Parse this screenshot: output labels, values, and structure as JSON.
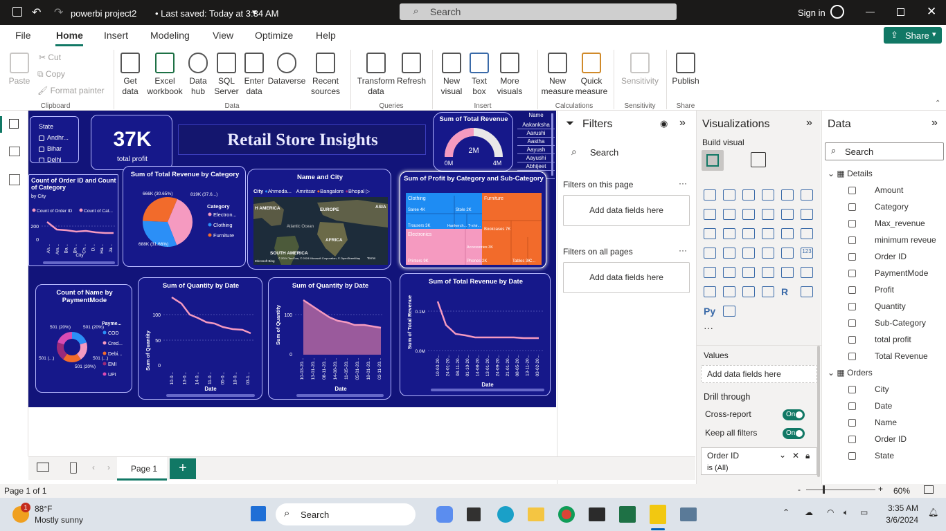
{
  "titlebar": {
    "file_name": "powerbi project2",
    "saved": "• Last saved: Today at 3:34 AM",
    "search": "Search",
    "signin": "Sign in"
  },
  "tabs": [
    "File",
    "Home",
    "Insert",
    "Modeling",
    "View",
    "Optimize",
    "Help"
  ],
  "share": "Share",
  "ribbon": {
    "clipboard": {
      "paste": "Paste",
      "cut": "Cut",
      "copy": "Copy",
      "format_painter": "Format painter",
      "group": "Clipboard"
    },
    "data": {
      "items": [
        "Get data",
        "Excel workbook",
        "Data hub",
        "SQL Server",
        "Enter data",
        "Dataverse",
        "Recent sources"
      ],
      "group": "Data"
    },
    "queries": {
      "items": [
        "Transform data",
        "Refresh"
      ],
      "group": "Queries"
    },
    "insert": {
      "items": [
        "New visual",
        "Text box",
        "More visuals"
      ],
      "group": "Insert"
    },
    "calculations": {
      "items": [
        "New measure",
        "Quick measure"
      ],
      "group": "Calculations"
    },
    "sensitivity": {
      "items": [
        "Sensitivity"
      ],
      "group": "Sensitivity"
    },
    "share": {
      "items": [
        "Publish"
      ],
      "group": "Share"
    }
  },
  "report": {
    "title": "Retail Store Insights",
    "kpi": {
      "value": "37K",
      "label": "total profit"
    },
    "state_slicer": {
      "title": "State",
      "items": [
        "Andhr...",
        "Bihar",
        "Delhi"
      ]
    },
    "name_slicer": {
      "title": "Name",
      "items": [
        "Aakanksha",
        "Aarushi",
        "Aastha",
        "Aayush",
        "Aayushi",
        "Abhijeet",
        "Abhiji..."
      ]
    },
    "gauge": {
      "title": "Sum of Total Revenue",
      "value": "2M",
      "min": "0M",
      "max": "4M",
      "fraction": 0.5
    },
    "combo": {
      "title": "Count of Order ID and Count of Category",
      "subtitle": "by City",
      "legend": [
        "Count of Order ID",
        "Count of Cat..."
      ],
      "y_ticks": [
        "200",
        "0"
      ],
      "x_label": "City",
      "x_ticks": [
        "Ah...",
        "Am...",
        "Ba...",
        "Bh...",
        "Ch...",
        "D...",
        "Ha...",
        "Ja..."
      ]
    },
    "pie": {
      "title": "Sum of Total Revenue by Category",
      "legend_title": "Category",
      "legend": [
        "Electron...",
        "Clothing",
        "Furniture"
      ],
      "labels": [
        "819K (37.6...)",
        "688K (31.66%)",
        "666K (30.65%)"
      ]
    },
    "map": {
      "title": "Name and City",
      "legend_title": "City",
      "legend": [
        "Ahmeda...",
        "Amritsar",
        "Bangalore",
        "Bhopal"
      ],
      "regions": [
        "H AMERICA",
        "EUROPE",
        "ASIA",
        "Atlantic Ocean",
        "AFRICA",
        "SOUTH AMERICA"
      ],
      "credit": "© 2024 TomTom, © 2024 Microsoft Corporation, © OpenStreetMap",
      "terms": "Terms",
      "brand": "Microsoft Bing"
    },
    "treemap": {
      "title": "Sum of Profit by Category and Sub-Category",
      "tiles": [
        "Clothing",
        "Furniture",
        "Saree 4K",
        "Stole 2K",
        "Trousers 3K",
        "Hankerch...",
        "T-shir...",
        "Bookcases 7K",
        "Electronics",
        "Accessories 3K",
        "Printers 9K",
        "Phones 2K",
        "Tables 3K",
        "C..."
      ]
    },
    "donut": {
      "title": "Count of Name by PaymentMode",
      "legend_title": "Payme...",
      "legend": [
        "COD",
        "Cred...",
        "Debi...",
        "EMI",
        "UPI"
      ],
      "labels": [
        "501 (20%)",
        "501 (20%)",
        "501 (...)",
        "501 (20%)",
        "501 (...)"
      ]
    },
    "qty1": {
      "title": "Sum of Quantity by Date",
      "y_label": "Sum of Quantity",
      "x_label": "Date",
      "y_ticks": [
        "100",
        "50",
        "0"
      ],
      "x_ticks": [
        "10-0...",
        "13-0...",
        "14-0...",
        "11-0...",
        "05-0...",
        "18-0...",
        "03-1..."
      ]
    },
    "qty2": {
      "title": "Sum of Quantity by Date",
      "y_label": "Sum of Quantity",
      "x_label": "Date",
      "y_ticks": [
        "100",
        "0"
      ],
      "x_ticks": [
        "10-03-20...",
        "13-01-20...",
        "08-11-20...",
        "14-08-20...",
        "11-05-20...",
        "05-01-20...",
        "18-01-20...",
        "03-11-20..."
      ]
    },
    "rev": {
      "title": "Sum of Total Revenue by Date",
      "y_label": "Sum of Total Revenue",
      "x_label": "Date",
      "y_ticks": [
        "0.1M",
        "0.0M"
      ],
      "x_ticks": [
        "10-03-20...",
        "24-01-20...",
        "08-11-20...",
        "01-10-20...",
        "14-08-20...",
        "13-01-20...",
        "24-09-20...",
        "21-01-20...",
        "08-05-20...",
        "13-11-20...",
        "03-02-20..."
      ]
    }
  },
  "filters": {
    "title": "Filters",
    "search": "Search",
    "on_page": "Filters on this page",
    "on_all": "Filters on all pages",
    "add": "Add data fields here"
  },
  "viz": {
    "title": "Visualizations",
    "build": "Build visual",
    "values": "Values",
    "add": "Add data fields here",
    "drill": "Drill through",
    "cross": "Cross-report",
    "keep": "Keep all filters",
    "on": "On",
    "order_filter": "Order ID",
    "order_filter_val": "is (All)",
    "icon_labels": [
      "Py",
      "R",
      "123"
    ]
  },
  "data_pane": {
    "title": "Data",
    "search": "Search",
    "tables": [
      {
        "name": "Details",
        "fields": [
          "Amount",
          "Category",
          "Max_revenue",
          "minimum reveue",
          "Order ID",
          "PaymentMode",
          "Profit",
          "Quantity",
          "Sub-Category",
          "total profit",
          "Total Revenue"
        ]
      },
      {
        "name": "Orders",
        "fields": [
          "City",
          "Date",
          "Name",
          "Order ID",
          "State"
        ]
      }
    ]
  },
  "pages": {
    "current": "Page 1",
    "add": "+"
  },
  "status": {
    "page": "Page 1 of 1",
    "zoom": "60%"
  },
  "taskbar": {
    "weather_temp": "88°F",
    "weather_desc": "Mostly sunny",
    "search": "Search",
    "time": "3:35 AM",
    "date": "3/6/2024",
    "badge": "1"
  }
}
